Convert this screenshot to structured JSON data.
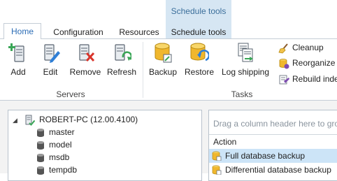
{
  "context_tab_group": {
    "title": "Schedule tools"
  },
  "tabs": [
    {
      "label": "Home"
    },
    {
      "label": "Configuration"
    },
    {
      "label": "Resources"
    },
    {
      "label": "Schedule tools"
    }
  ],
  "ribbon": {
    "servers_group": {
      "label": "Servers",
      "buttons": [
        {
          "label": "Add",
          "icon": "server-add-icon"
        },
        {
          "label": "Edit",
          "icon": "server-edit-icon"
        },
        {
          "label": "Remove",
          "icon": "server-remove-icon"
        },
        {
          "label": "Refresh",
          "icon": "server-refresh-icon"
        }
      ]
    },
    "tasks_group": {
      "label": "Tasks",
      "buttons": [
        {
          "label": "Backup",
          "icon": "database-backup-icon"
        },
        {
          "label": "Restore",
          "icon": "database-restore-icon"
        },
        {
          "label": "Log shipping",
          "icon": "log-shipping-icon"
        }
      ],
      "small_buttons": [
        {
          "label": "Cleanup",
          "icon": "broom-icon"
        },
        {
          "label": "Reorganize i",
          "icon": "reorganize-icon"
        },
        {
          "label": "Rebuild inde",
          "icon": "rebuild-index-icon"
        }
      ]
    }
  },
  "tree": {
    "root": {
      "label": "ROBERT-PC (12.00.4100)",
      "expanded": true,
      "checked": true
    },
    "databases": [
      "master",
      "model",
      "msdb",
      "tempdb"
    ]
  },
  "grid": {
    "group_hint": "Drag a column header here to grou",
    "column_header": "Action",
    "rows": [
      {
        "label": "Full database backup",
        "selected": true
      },
      {
        "label": "Differential database backup",
        "selected": false
      }
    ]
  },
  "colors": {
    "accent": "#2b6cb5",
    "context_band": "#d6e6f3",
    "selection": "#cce4f7"
  }
}
